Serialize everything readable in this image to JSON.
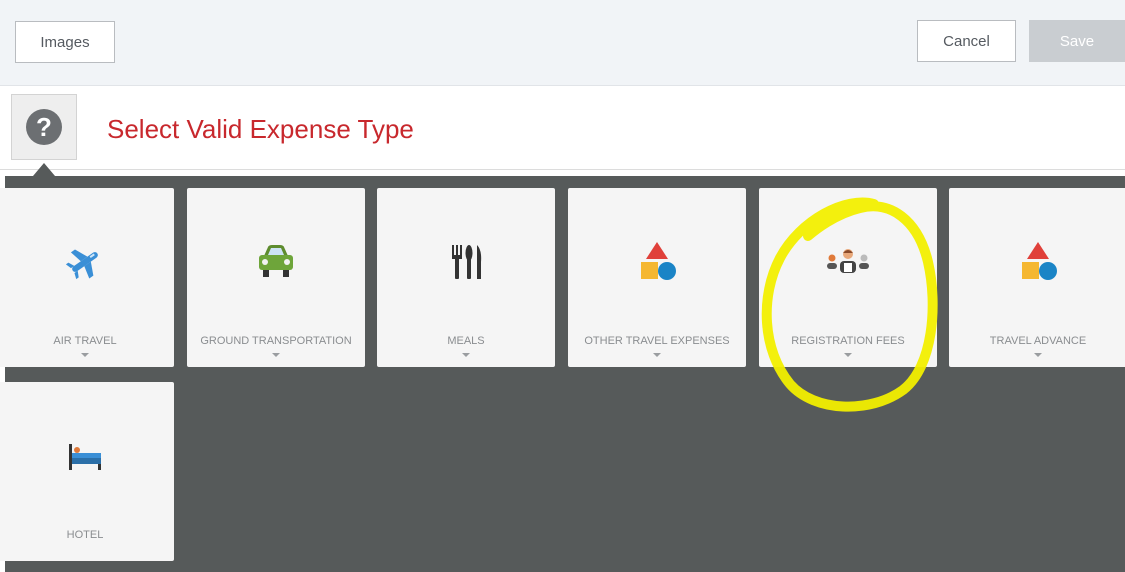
{
  "toolbar": {
    "images_label": "Images",
    "cancel_label": "Cancel",
    "save_label": "Save"
  },
  "header": {
    "help_icon": "question-icon",
    "title": "Select Valid Expense Type"
  },
  "expense_types": [
    {
      "label": "AIR TRAVEL",
      "icon": "airplane-icon"
    },
    {
      "label": "GROUND TRANSPORTATION",
      "icon": "car-icon"
    },
    {
      "label": "MEALS",
      "icon": "utensils-icon"
    },
    {
      "label": "OTHER TRAVEL EXPENSES",
      "icon": "shapes-icon"
    },
    {
      "label": "REGISTRATION FEES",
      "icon": "people-icon"
    },
    {
      "label": "TRAVEL ADVANCE",
      "icon": "shapes-icon"
    },
    {
      "label": "HOTEL",
      "icon": "bed-icon"
    }
  ],
  "colors": {
    "title": "#c8282d",
    "grid_background": "#565a5a",
    "tile": "#f5f5f5",
    "highlight": "#f2ef00"
  }
}
